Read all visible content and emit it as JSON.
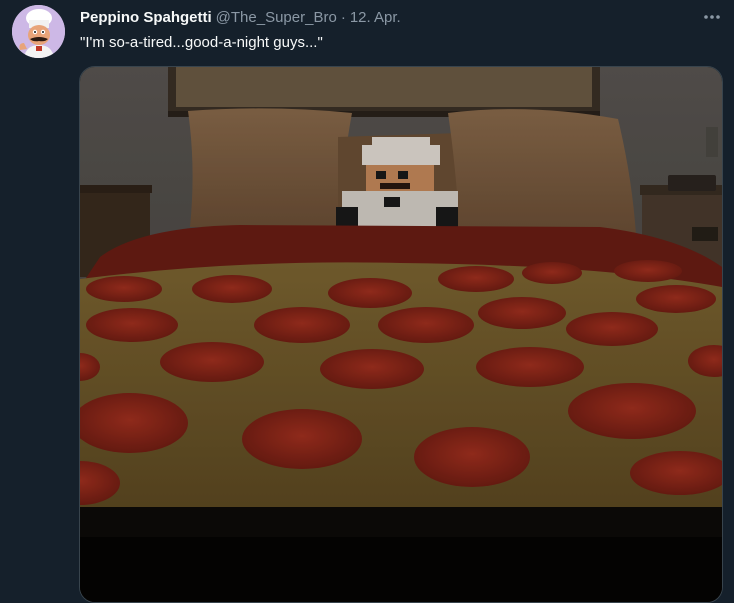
{
  "tweet": {
    "display_name": "Peppino Spahgetti",
    "handle": "@The_Super_Bro",
    "separator": "·",
    "timestamp": "12. Apr.",
    "text": "\"I'm so-a-tired...good-a-night guys...\"",
    "more_icon": "more-horizontal-icon",
    "avatar_icon": "chef-avatar",
    "media_subject": "pizza-bedspread-photo"
  },
  "colors": {
    "background": "#15202b",
    "primary_text": "#f7f9f9",
    "secondary_text": "#8b98a5",
    "media_border": "#38444d"
  }
}
